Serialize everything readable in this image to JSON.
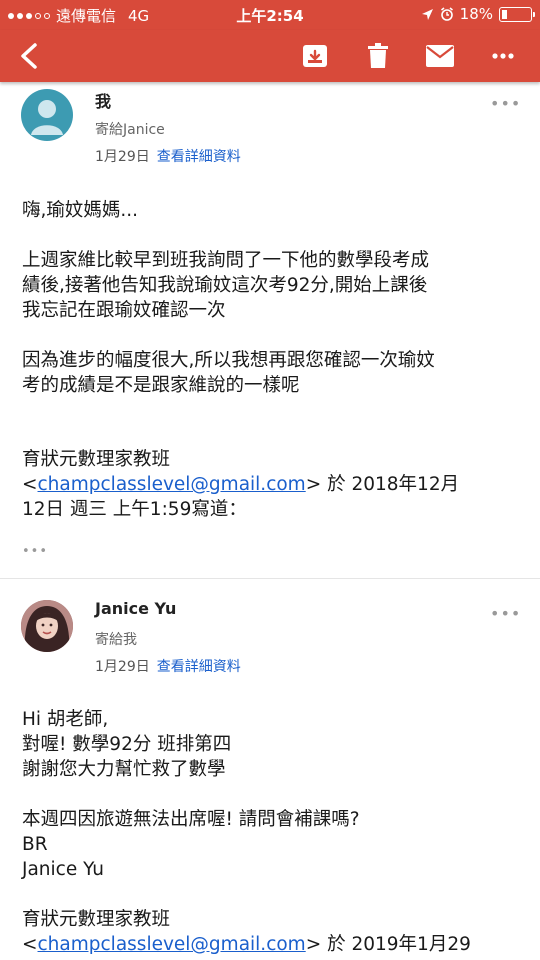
{
  "status_bar": {
    "carrier": "遠傳電信",
    "network": "4G",
    "time": "上午2:54",
    "battery": "18%"
  },
  "toolbar": {
    "back_icon": "back-arrow-icon",
    "archive_icon": "archive-icon",
    "trash_icon": "trash-icon",
    "mail_icon": "mail-icon",
    "more_icon": "more-vert-icon"
  },
  "colors": {
    "header": "#d84a3a",
    "link": "#1a5fcc"
  },
  "messages": [
    {
      "sender": "我",
      "to": "寄給Janice",
      "date": "1月29日",
      "details_link": "查看詳細資料",
      "body": [
        "嗨,瑜妏媽媽...",
        "上週家維比較早到班我詢問了一下他的數學段考成",
        "績後,接著他告知我說瑜妏這次考92分,開始上課後",
        "我忘記在跟瑜妏確認一次",
        "因為進步的幅度很大,所以我想再跟您確認一次瑜妏",
        "考的成績是不是跟家維說的一樣呢"
      ],
      "quote": {
        "name": "育狀元數理家教班",
        "lt": "<",
        "email": "champclasslevel@gmail.com",
        "after_email": "> 於 2018年12月",
        "line2": "12日 週三 上午1:59寫道："
      },
      "expand": "•••"
    },
    {
      "sender": "Janice Yu",
      "to": "寄給我",
      "date": "1月29日",
      "details_link": "查看詳細資料",
      "body": [
        "Hi 胡老師,",
        "對喔! 數學92分 班排第四",
        "謝謝您大力幫忙救了數學",
        "本週四因旅遊無法出席喔! 請問會補課嗎?",
        "BR",
        "Janice Yu"
      ],
      "quote": {
        "name": "育狀元數理家教班",
        "lt": "<",
        "email": "champclasslevel@gmail.com",
        "after_email": "> 於 2019年1月29"
      }
    }
  ]
}
